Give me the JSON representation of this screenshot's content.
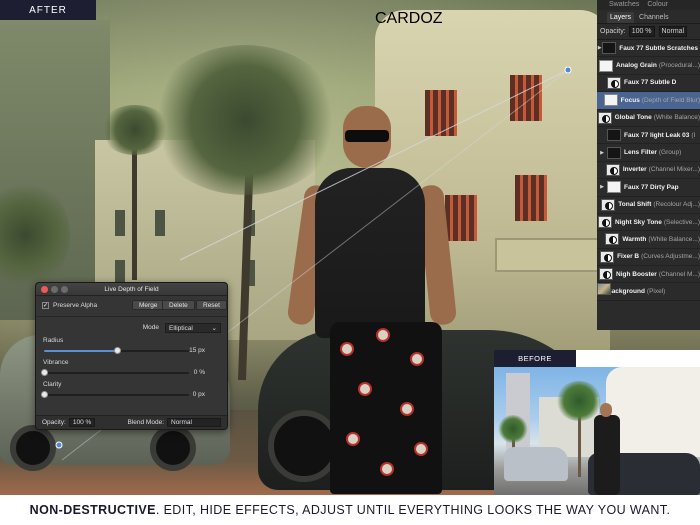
{
  "labels": {
    "after": "AFTER",
    "before": "BEFORE"
  },
  "layers_panel": {
    "top_tabs": [
      "Swatches",
      "Colour"
    ],
    "tabs": [
      "Layers",
      "Channels"
    ],
    "active_tab": "Layers",
    "opacity_label": "Opacity:",
    "opacity_value": "100 %",
    "blend_mode": "Normal",
    "layers": [
      {
        "name": "Faux 77 Subtle Scratches",
        "sub": "",
        "thumb": "dark",
        "expand": "▶",
        "selected": false
      },
      {
        "name": "Analog Grain",
        "sub": "(Procedural...)",
        "thumb": "white",
        "expand": "",
        "selected": false
      },
      {
        "name": "Faux 77 Subtle D",
        "sub": "",
        "thumb": "adj",
        "expand": "",
        "selected": false
      },
      {
        "name": "Focus",
        "sub": "(Depth of Field Blur)",
        "thumb": "white",
        "expand": "",
        "selected": true
      },
      {
        "name": "Global Tone",
        "sub": "(White Balance)",
        "thumb": "adj",
        "expand": "",
        "selected": false
      },
      {
        "name": "Faux 77 light Leak 03",
        "sub": "(I",
        "thumb": "dark",
        "expand": "",
        "selected": false
      },
      {
        "name": "Lens Filter",
        "sub": "(Group)",
        "thumb": "dark",
        "expand": "▶",
        "selected": false
      },
      {
        "name": "Inverter",
        "sub": "(Channel Mixer...)",
        "thumb": "adj",
        "expand": "",
        "selected": false
      },
      {
        "name": "Faux 77 Dirty Pap",
        "sub": "",
        "thumb": "white",
        "expand": "▶",
        "selected": false
      },
      {
        "name": "Tonal Shift",
        "sub": "(Recolour Adj...)",
        "thumb": "adj",
        "expand": "",
        "selected": false
      },
      {
        "name": "Night Sky Tone",
        "sub": "(Selective...)",
        "thumb": "adj",
        "expand": "",
        "selected": false
      },
      {
        "name": "Warmth",
        "sub": "(White Balance...)",
        "thumb": "adj",
        "expand": "",
        "selected": false
      },
      {
        "name": "Fixer B",
        "sub": "(Curves Adjustme...)",
        "thumb": "adj",
        "expand": "",
        "selected": false
      },
      {
        "name": "Nigh Booster",
        "sub": "(Channel M...)",
        "thumb": "adj",
        "expand": "",
        "selected": false
      },
      {
        "name": "Background",
        "sub": "(Pixel)",
        "thumb": "photo",
        "expand": "",
        "selected": false
      }
    ]
  },
  "dof_dialog": {
    "title": "Live Depth of Field",
    "preserve_alpha": "Preserve Alpha",
    "preserve_alpha_checked": true,
    "buttons": [
      "Merge",
      "Delete",
      "Reset"
    ],
    "mode_label": "Mode",
    "mode_value": "Elliptical",
    "sliders": [
      {
        "label": "Radius",
        "value": "15 px",
        "fraction": 0.5
      },
      {
        "label": "Vibrance",
        "value": "0 %",
        "fraction": 0.0
      },
      {
        "label": "Clarity",
        "value": "0 px",
        "fraction": 0.0
      }
    ],
    "opacity_label": "Opacity:",
    "opacity_value": "100 %",
    "blend_label": "Blend Mode:",
    "blend_value": "Normal"
  },
  "photo": {
    "sign_text": "CARDOZ"
  },
  "caption": {
    "strong": "NON-DESTRUCTIVE",
    "rest": ". EDIT, HIDE EFFECTS, ADJUST UNTIL EVERYTHING LOOKS THE WAY YOU WANT."
  },
  "colors": {
    "label_bg": "#1e1e33",
    "panel_bg": "#2b2b2b",
    "selected_layer": "#4a6591",
    "slider_fill": "#5b8fd6",
    "caption_text": "#1a1a2e"
  }
}
